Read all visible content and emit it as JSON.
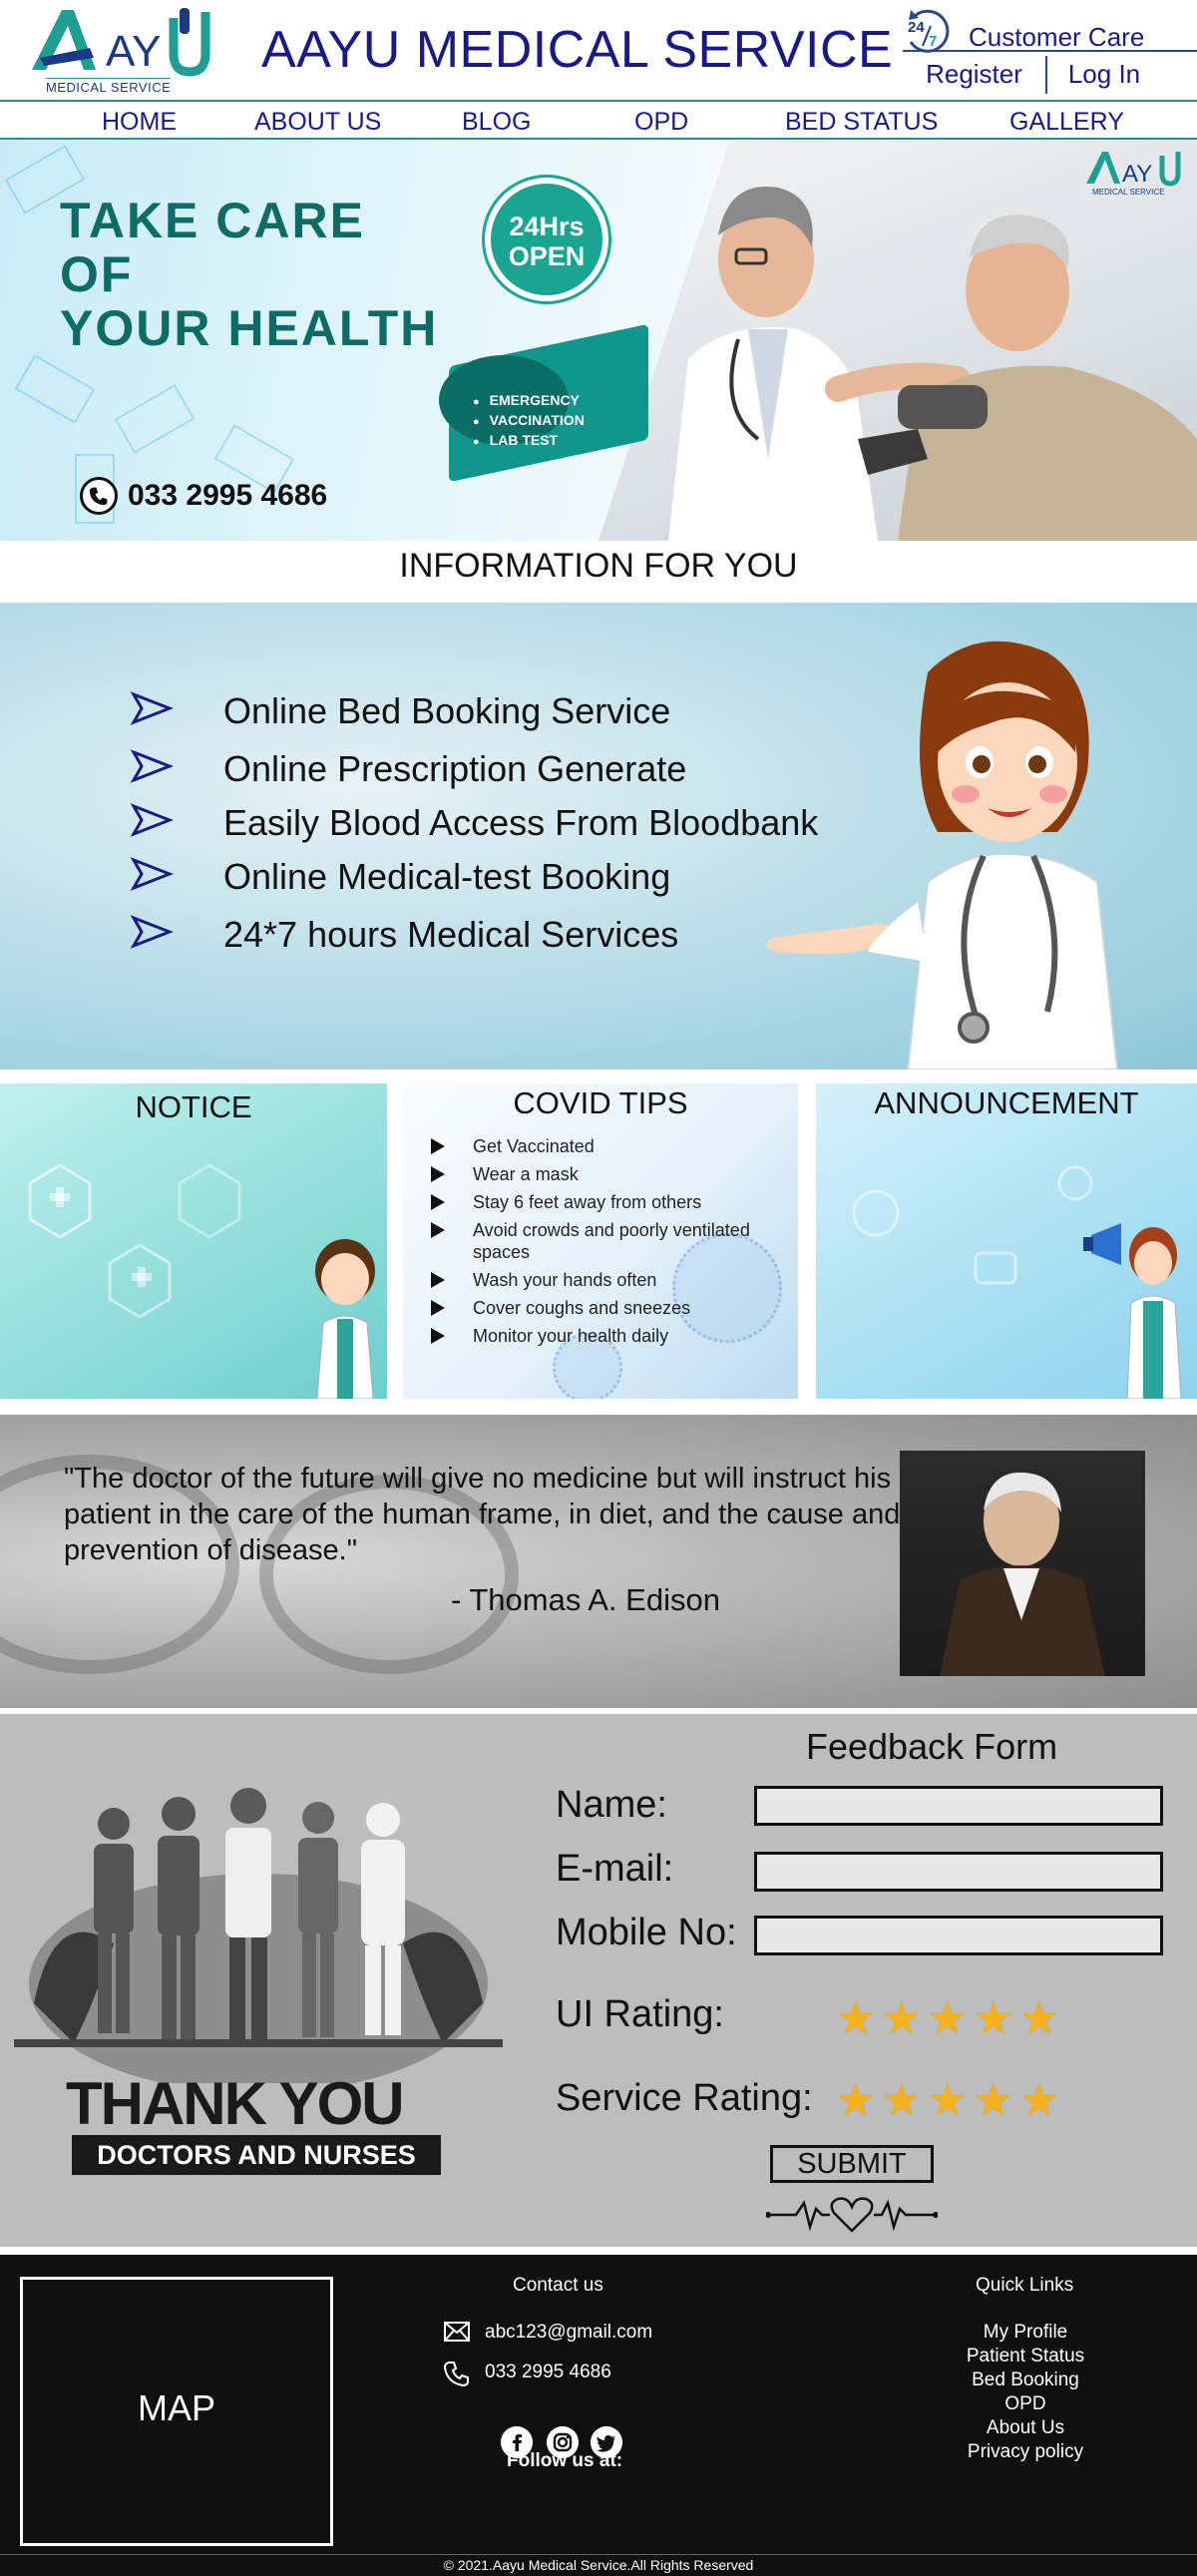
{
  "header": {
    "logo_text": "AAYU",
    "logo_sub": "MEDICAL SERVICE",
    "site_title": "AAYU MEDICAL SERVICE",
    "care_badge": "24/7",
    "care_label": "Customer Care",
    "register": "Register",
    "login": "Log In"
  },
  "nav": [
    "HOME",
    "ABOUT US",
    "BLOG",
    "OPD",
    "BED STATUS",
    "GALLERY"
  ],
  "hero": {
    "heading": [
      "TAKE CARE",
      "OF",
      "YOUR HEALTH"
    ],
    "badge_top": "24Hrs",
    "badge_bottom": "OPEN",
    "services": [
      "EMERGENCY",
      "VACCINATION",
      "LAB TEST"
    ],
    "phone": "033 2995 4686",
    "logo_text": "AAYU",
    "logo_sub": "MEDICAL SERVICE"
  },
  "info": {
    "title": "INFORMATION FOR YOU",
    "items": [
      "Online Bed Booking Service",
      "Online Prescription Generate",
      "Easily Blood Access From Bloodbank",
      "Online Medical-test Booking",
      "24*7 hours Medical Services"
    ]
  },
  "panels": {
    "notice_title": "NOTICE",
    "covid_title": "COVID TIPS",
    "covid_tips": [
      "Get Vaccinated",
      "Wear a mask",
      "Stay 6 feet away from others",
      "Avoid crowds and poorly ventilated spaces",
      "Wash your hands often",
      "Cover coughs and sneezes",
      "Monitor your health daily"
    ],
    "announcement_title": "ANNOUNCEMENT"
  },
  "quote": {
    "text": "\"The doctor of the future will give no medicine but will instruct his patient in the care of the human frame, in diet, and the cause and prevention of disease.\"",
    "author": "- Thomas A. Edison"
  },
  "feedback": {
    "title": "Feedback Form",
    "name_label": "Name:",
    "email_label": "E-mail:",
    "mobile_label": "Mobile No:",
    "name_value": "",
    "email_value": "",
    "mobile_value": "",
    "ui_rating_label": "UI Rating:",
    "ui_rating": 5,
    "service_rating_label": "Service Rating:",
    "service_rating": 5,
    "rating_max": 5,
    "submit": "SUBMIT",
    "thank_you": "THANK YOU",
    "thank_you_sub": "DOCTORS AND NURSES"
  },
  "footer": {
    "map": "MAP",
    "contact_title": "Contact us",
    "email": "abc123@gmail.com",
    "phone": "033 2995 4686",
    "follow_title": "Follow us at:",
    "social_icons": [
      "facebook-icon",
      "instagram-icon",
      "twitter-icon"
    ],
    "quick_title": "Quick Links",
    "quick_links": [
      "My Profile",
      "Patient Status",
      "Bed Booking",
      "OPD",
      "About Us",
      "Privacy policy"
    ],
    "copyright": "© 2021.Aayu Medical Service.All Rights Reserved"
  },
  "colors": {
    "brand_navy": "#1a1a86",
    "brand_teal": "#1f9e92",
    "hero_teal": "#0f6b66",
    "star": "#f5b21c",
    "footer_bg": "#0f0f0f",
    "feedback_bg": "#bdbdbd"
  }
}
